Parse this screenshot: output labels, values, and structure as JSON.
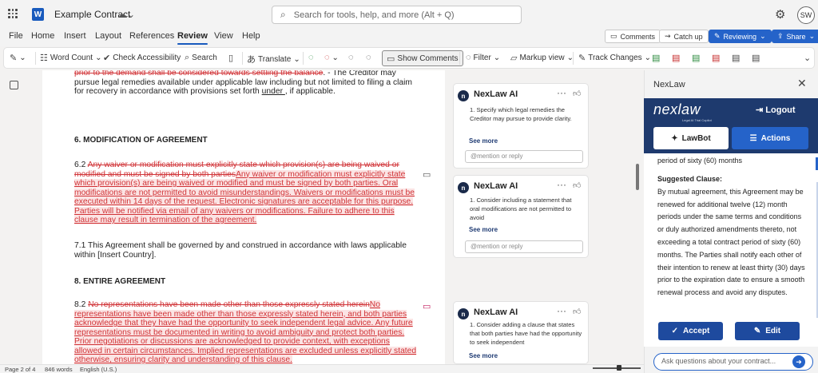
{
  "titlebar": {
    "app_icon": "W",
    "doc_title": "Example Contract",
    "search_placeholder": "Search for tools, help, and more (Alt + Q)",
    "user_initials": "SW"
  },
  "menu": {
    "tabs": [
      "File",
      "Home",
      "Insert",
      "Layout",
      "References",
      "Review",
      "View",
      "Help"
    ],
    "active": "Review",
    "comments_btn": "Comments",
    "catchup_btn": "Catch up",
    "reviewing_btn": "Reviewing",
    "share_btn": "Share"
  },
  "ribbon": {
    "word_count": "Word Count",
    "check_accessibility": "Check Accessibility",
    "search": "Search",
    "translate": "Translate",
    "show_comments": "Show Comments",
    "filter": "Filter",
    "markup_view": "Markup view",
    "track_changes": "Track Changes"
  },
  "document": {
    "top_del": "prior to the demand shall be considered towards settling the ",
    "top_del_word": "balance",
    "top_line1_tail": ". - The Creditor may",
    "top_line2": "pursue legal remedies available under applicable law including but not limited to filing a claim",
    "top_line3": "for recovery in accordance with provisions set forth ",
    "top_line3_ul": "under ",
    "top_line3_tail": ", if applicable.",
    "h6": "6. MODIFICATION OF AGREEMENT",
    "p62_num": "6.2 ",
    "p62_del1": "Any waiver or modification must explicitly state which provision(s) are being waived or",
    "p62_del2": "modified and must be signed by both parties",
    "p62_ins": "Any waiver or modification must explicitly state which provision(s) are being waived or modified and must be signed by both parties. Oral modifications are not permitted to avoid misunderstandings. Waivers or modifications must be executed within 14 days of the request. Electronic signatures are acceptable for this purpose. Parties will be notified via email of any waivers or modifications. Failure to adhere to this clause may result in termination of the agreement",
    "p71": "7.1 This Agreement shall be governed by and construed in accordance with laws applicable within [Insert Country].",
    "h8": "8. ENTIRE AGREEMENT",
    "p82_num": "8.2 ",
    "p82_del": "No representations have been made other than those expressly stated herein",
    "p82_ins": "No representations have been made other than those expressly stated herein, and both parties acknowledge that they have had the opportunity to seek independent legal advice. Any future representations must be documented in writing to avoid ambiguity and protect both parties. Prior negotiations or discussions are acknowledged to provide context, with exceptions allowed in certain circumstances. Implied representations are excluded unless explicitly stated otherwise, ensuring clarity and understanding of this clause."
  },
  "comments": [
    {
      "author": "NexLaw AI",
      "text": "1. Specify which legal remedies the Creditor may pursue to provide clarity.",
      "see_more": "See more",
      "reply_placeholder": "@mention or reply"
    },
    {
      "author": "NexLaw AI",
      "text": "1. Consider including a statement that oral modifications are not permitted to avoid",
      "see_more": "See more",
      "reply_placeholder": "@mention or reply"
    },
    {
      "author": "NexLaw AI",
      "text": "1. Consider adding a clause that states that both parties have had the opportunity to seek independent",
      "see_more": "See more"
    }
  ],
  "pane": {
    "title": "NexLaw",
    "logo": "nexlaw",
    "logo_sub": "Legal AI Trial Copilot",
    "logout": "Logout",
    "tab_lawbot": "LawBot",
    "tab_actions": "Actions",
    "text_top": "period of sixty (60) months",
    "suggested_label": "Suggested Clause:",
    "suggested_text": "By mutual agreement, this Agreement may be renewed for additional twelve (12) month periods under the same terms and conditions or duly authorized amendments thereto, not exceeding a total contract period of sixty (60) months. The Parties shall notify each other of their intention to renew at least thirty (30) days prior to the expiration date to ensure a smooth renewal process and avoid any disputes.",
    "accept": "Accept",
    "edit": "Edit",
    "ask_placeholder": "Ask questions about your contract..."
  },
  "status": {
    "page": "Page 2 of 4",
    "words": "846 words",
    "language": "English (U.S.)"
  },
  "colors": {
    "accent": "#2563c9",
    "brand_navy": "#1e3a6e",
    "tracked_change": "#d13438",
    "insert_highlight": "#fbe4e4"
  }
}
